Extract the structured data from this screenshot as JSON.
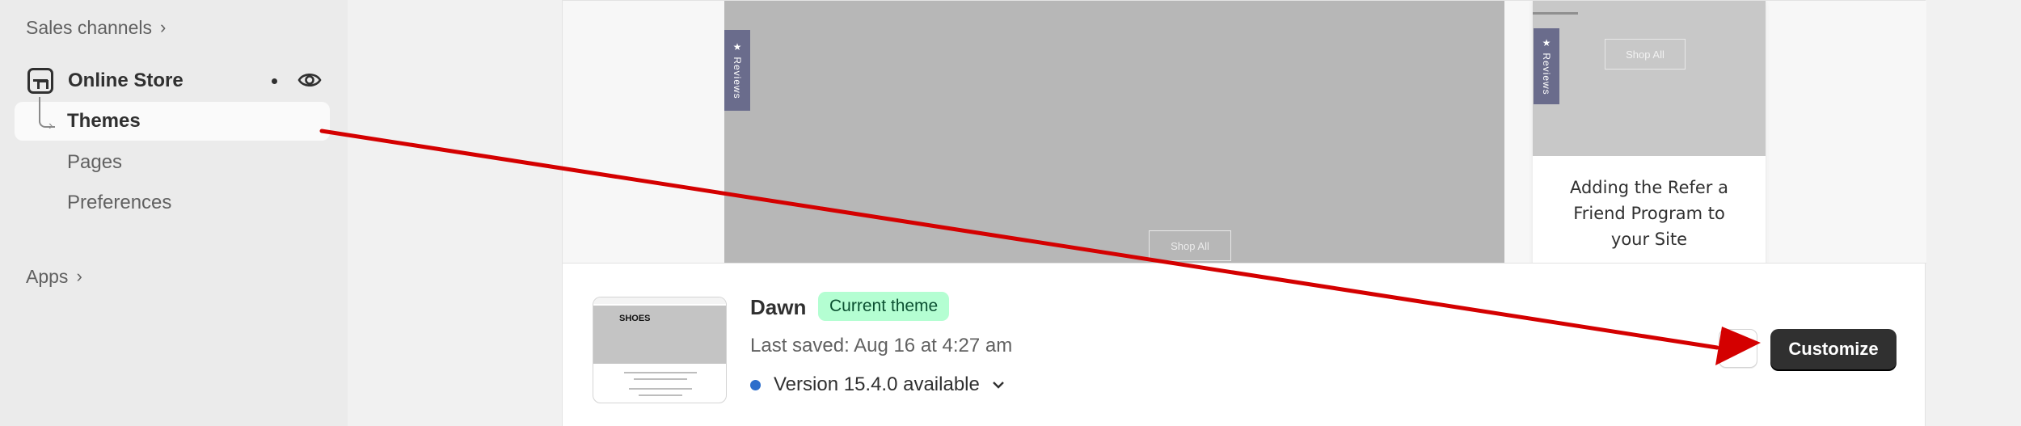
{
  "sidebar": {
    "sales_channels": "Sales channels",
    "online_store": "Online Store",
    "themes": "Themes",
    "pages": "Pages",
    "preferences": "Preferences",
    "apps": "Apps"
  },
  "preview": {
    "reviews_tab": "★ Reviews",
    "shop_all": "Shop All",
    "card_text": "Adding the Refer a Friend Program to your Site"
  },
  "theme": {
    "name": "Dawn",
    "badge": "Current theme",
    "last_saved": "Last saved: Aug 16 at 4:27 am",
    "version": "Version 15.4.0 available",
    "thumbnail_title": "SHOES",
    "customize_label": "Customize"
  },
  "colors": {
    "annotation_arrow": "#d40000",
    "badge_bg": "#b4fed2",
    "version_dot": "#2c6ecb",
    "primary_button": "#303030"
  },
  "icons": {
    "store": "store-icon",
    "eye": "eye-icon",
    "chevron": "chevron-right-icon",
    "version_chevron": "chevron-down-icon"
  }
}
